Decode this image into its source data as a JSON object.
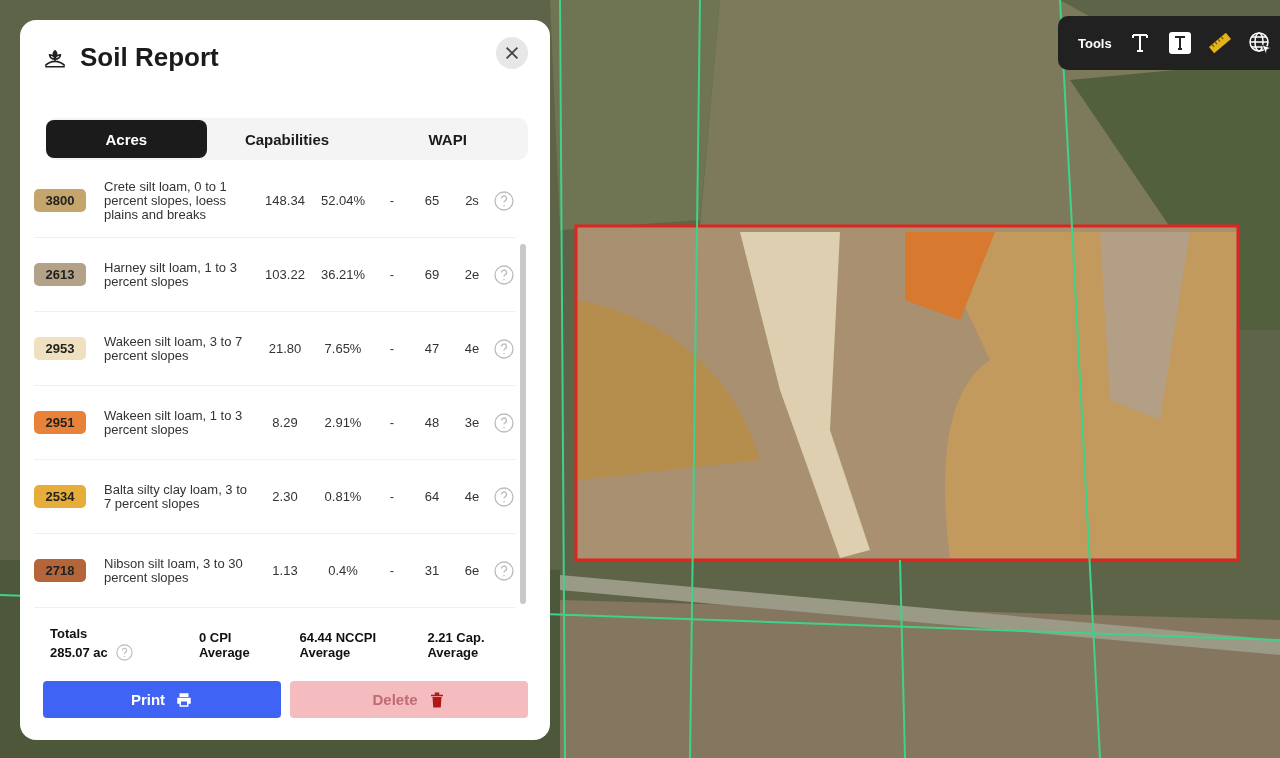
{
  "toolbar": {
    "label": "Tools",
    "tools": [
      {
        "kind": "text"
      },
      {
        "kind": "text-box"
      },
      {
        "kind": "ruler"
      },
      {
        "kind": "globe"
      }
    ]
  },
  "panel": {
    "title": "Soil Report",
    "tabs": [
      {
        "label": "Acres",
        "selected": true
      },
      {
        "label": "Capabilities",
        "selected": false
      },
      {
        "label": "WAPI",
        "selected": false
      }
    ],
    "rows": [
      {
        "code": "3800",
        "color": "#c4a56b",
        "name": "Crete silt loam, 0 to 1 percent slopes, loess plains and breaks",
        "acres": "148.34",
        "percent": "52.04%",
        "cpi": "-",
        "nccpi": "65",
        "cap": "2s"
      },
      {
        "code": "2613",
        "color": "#b3a287",
        "name": "Harney silt loam, 1 to 3 percent slopes",
        "acres": "103.22",
        "percent": "36.21%",
        "cpi": "-",
        "nccpi": "69",
        "cap": "2e"
      },
      {
        "code": "2953",
        "color": "#efe0bf",
        "name": "Wakeen silt loam, 3 to 7 percent slopes",
        "acres": "21.80",
        "percent": "7.65%",
        "cpi": "-",
        "nccpi": "47",
        "cap": "4e"
      },
      {
        "code": "2951",
        "color": "#e8813a",
        "name": "Wakeen silt loam, 1 to 3 percent slopes",
        "acres": "8.29",
        "percent": "2.91%",
        "cpi": "-",
        "nccpi": "48",
        "cap": "3e"
      },
      {
        "code": "2534",
        "color": "#e6ad3a",
        "name": "Balta silty clay loam, 3 to 7 percent slopes",
        "acres": "2.30",
        "percent": "0.81%",
        "cpi": "-",
        "nccpi": "64",
        "cap": "4e"
      },
      {
        "code": "2718",
        "color": "#b4653a",
        "name": "Nibson silt loam, 3 to 30 percent slopes",
        "acres": "1.13",
        "percent": "0.4%",
        "cpi": "-",
        "nccpi": "31",
        "cap": "6e"
      }
    ],
    "totals": {
      "label": "Totals",
      "acres": "285.07 ac",
      "averages": [
        {
          "value": "0 CPI",
          "label": "Average"
        },
        {
          "value": "64.44 NCCPI",
          "label": "Average"
        },
        {
          "value": "2.21 Cap.",
          "label": "Average"
        }
      ]
    },
    "buttons": [
      {
        "kind": "print",
        "label": "Print",
        "disabled": false
      },
      {
        "kind": "delete",
        "label": "Delete",
        "disabled": true
      }
    ]
  }
}
